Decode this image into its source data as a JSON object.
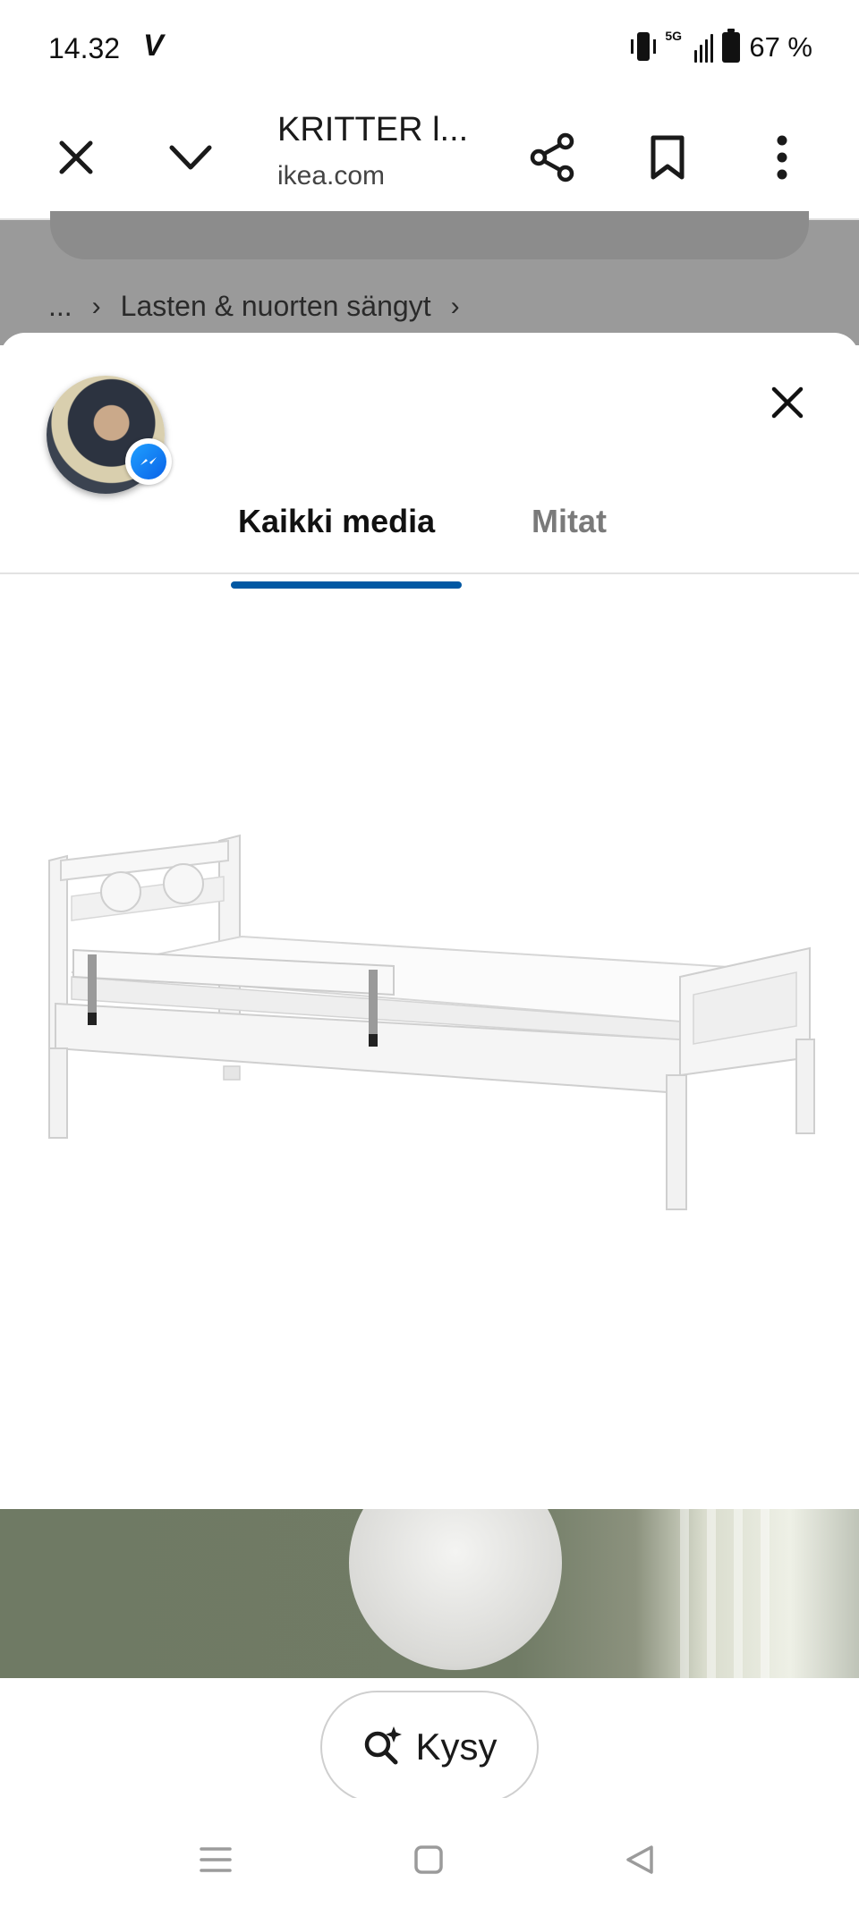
{
  "status_bar": {
    "time": "14.32",
    "carrier_glyph": "V",
    "network": "5G",
    "battery": "67 %",
    "icons": [
      "vibrate-icon",
      "signal-icon",
      "battery-icon"
    ]
  },
  "toolbar": {
    "title": "KRITTER l...",
    "domain": "ikea.com",
    "icons": [
      "close-icon",
      "chevron-down-icon",
      "share-icon",
      "bookmark-icon",
      "more-vertical-icon"
    ]
  },
  "background_page": {
    "breadcrumb": {
      "ellipsis": "...",
      "current": "Lasten & nuorten sängyt"
    }
  },
  "sheet": {
    "tabs": [
      {
        "label": "Kaikki media",
        "active": true
      },
      {
        "label": "Mitat",
        "active": false
      }
    ],
    "accent_color": "#0058a3",
    "close_icon": "close-icon",
    "avatar_badge_icon": "messenger-icon"
  },
  "ask": {
    "label": "Kysy",
    "icon": "ai-search-icon"
  },
  "system_nav": {
    "icons": [
      "recents-icon",
      "home-icon",
      "back-icon"
    ]
  }
}
